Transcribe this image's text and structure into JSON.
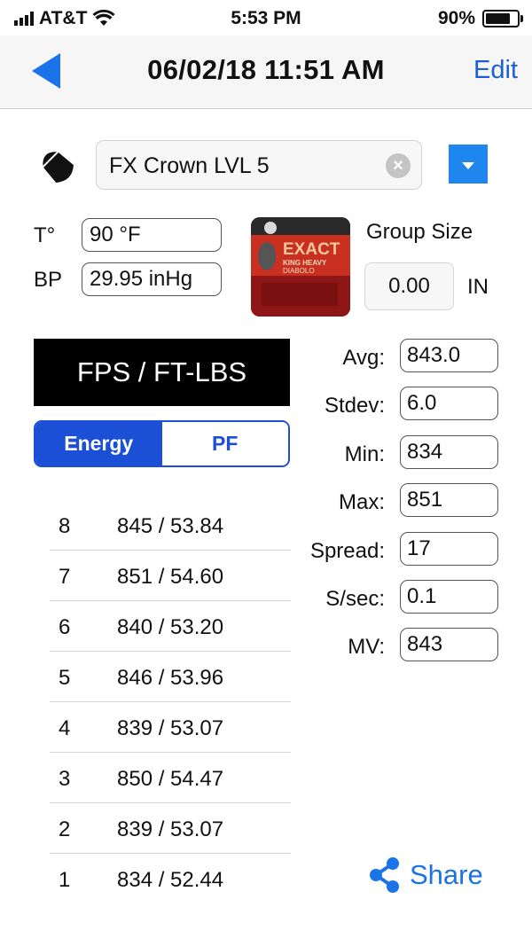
{
  "status_bar": {
    "carrier": "AT&T",
    "time": "5:53 PM",
    "battery": "90%",
    "battery_level": 0.9
  },
  "nav": {
    "title": "06/02/18 11:51 AM",
    "edit_label": "Edit"
  },
  "pellet": {
    "name": "FX Crown LVL 5"
  },
  "conditions": {
    "temp_label": "T°",
    "temp_value": "90 °F",
    "bp_label": "BP",
    "bp_value": "29.95 inHg"
  },
  "product_image": {
    "brand": "EXACT",
    "line1": "KING HEAVY",
    "line2": "DIABOLO"
  },
  "group_size": {
    "label": "Group Size",
    "value": "0.00",
    "unit": "IN"
  },
  "units_banner": "FPS / FT-LBS",
  "segmented": {
    "energy_label": "Energy",
    "pf_label": "PF",
    "selected": "Energy"
  },
  "shots": [
    {
      "n": "8",
      "value": "845 / 53.84"
    },
    {
      "n": "7",
      "value": "851 / 54.60"
    },
    {
      "n": "6",
      "value": "840 / 53.20"
    },
    {
      "n": "5",
      "value": "846 / 53.96"
    },
    {
      "n": "4",
      "value": "839 / 53.07"
    },
    {
      "n": "3",
      "value": "850 / 54.47"
    },
    {
      "n": "2",
      "value": "839 / 53.07"
    },
    {
      "n": "1",
      "value": "834 / 52.44"
    }
  ],
  "stats": [
    {
      "label": "Avg:",
      "value": "843.0"
    },
    {
      "label": "Stdev:",
      "value": "6.0"
    },
    {
      "label": "Min:",
      "value": "834"
    },
    {
      "label": "Max:",
      "value": "851"
    },
    {
      "label": "Spread:",
      "value": "17"
    },
    {
      "label": "S/sec:",
      "value": "0.1"
    },
    {
      "label": "MV:",
      "value": "843"
    }
  ],
  "share_label": "Share",
  "colors": {
    "accent": "#1b5fd6",
    "dropdown": "#1f86f0",
    "banner": "#000000"
  }
}
